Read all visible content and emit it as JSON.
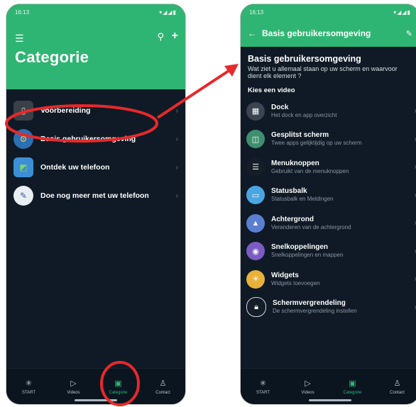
{
  "left": {
    "status": {
      "time": "16:13",
      "signals": "▾◢◢▮"
    },
    "header_title": "Categorie",
    "categories": [
      {
        "label": "Voorbereiding",
        "icon": "phone-icon"
      },
      {
        "label": "Basis gebruikersomgeving",
        "icon": "gear-badge-icon"
      },
      {
        "label": "Ontdek uw telefoon",
        "icon": "map-icon"
      },
      {
        "label": "Doe nog meer met uw telefoon",
        "icon": "tools-icon"
      }
    ],
    "nav": [
      {
        "label": "START",
        "icon": "sparkle-icon",
        "active": false
      },
      {
        "label": "Videos",
        "icon": "play-icon",
        "active": false
      },
      {
        "label": "Categorie",
        "icon": "category-icon",
        "active": true
      },
      {
        "label": "Contact",
        "icon": "person-icon",
        "active": false
      }
    ]
  },
  "right": {
    "status": {
      "time": "16:13",
      "signals": "▾◢◢▮"
    },
    "header_title": "Basis gebruikersomgeving",
    "intro_title": "Basis gebruikersomgeving",
    "intro_subtitle": "Wat ziet u allemaal staan op uw scherm en waarvoor dient elk element ?",
    "kies_label": "Kies een video",
    "videos": [
      {
        "title": "Dock",
        "subtitle": "Het dock en app overzicht",
        "icon": "grid-icon",
        "color": "#3b4552"
      },
      {
        "title": "Gesplitst scherm",
        "subtitle": "Twee apps gelijktijdig op uw scherm",
        "icon": "split-screen-icon",
        "color": "#3f8f6e"
      },
      {
        "title": "Menuknoppen",
        "subtitle": "Gebruikt van de menuknoppen",
        "icon": "menu-icon",
        "color": "#151e28"
      },
      {
        "title": "Statusbalk",
        "subtitle": "Statusbalk en Meldingen",
        "icon": "statusbar-icon",
        "color": "#4aa6e0"
      },
      {
        "title": "Achtergrond",
        "subtitle": "Veranderen van de achtergrond",
        "icon": "wallpaper-icon",
        "color": "#5a7fd0"
      },
      {
        "title": "Snelkoppelingen",
        "subtitle": "Snelkoppelingen en mappen",
        "icon": "shortcuts-icon",
        "color": "#7c5cc4"
      },
      {
        "title": "Widgets",
        "subtitle": "Widgets toevoegen",
        "icon": "weather-widget-icon",
        "color": "#e8b23a"
      },
      {
        "title": "Schermvergrendeling",
        "subtitle": "De schermvergrendeling instellen",
        "icon": "lock-icon",
        "color": "#151e28"
      }
    ],
    "nav": [
      {
        "label": "START",
        "icon": "sparkle-icon",
        "active": false
      },
      {
        "label": "Videos",
        "icon": "play-icon",
        "active": false
      },
      {
        "label": "Categorie",
        "icon": "category-icon",
        "active": true
      },
      {
        "label": "Contact",
        "icon": "person-icon",
        "active": false
      }
    ]
  },
  "colors": {
    "accent_green": "#2fb573",
    "dark_bg": "#0f1a26",
    "annotation_red": "#e8282a"
  }
}
